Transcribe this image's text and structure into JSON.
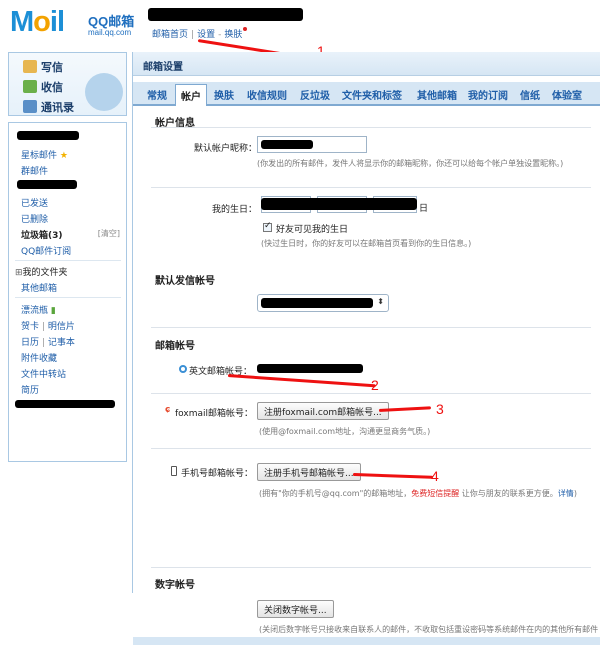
{
  "header": {
    "logo_main": "M",
    "logo_rest": "il",
    "logo_dot": "o",
    "product": "QQ邮箱",
    "domain": "mail.qq.com",
    "links": [
      "邮箱首页",
      "设置",
      "换肤"
    ]
  },
  "quick_actions": [
    "写信",
    "收信",
    "通讯录"
  ],
  "folders": {
    "starred": "星标邮件",
    "group": "群邮件",
    "sent": "已发送",
    "deleted": "已删除",
    "spam": "垃圾箱(3)",
    "clear": "[清空]",
    "subscriptions": "QQ邮件订阅",
    "my_folders": "我的文件夹",
    "other_accounts": "其他邮箱",
    "drift_bottle": "漂流瓶",
    "cards": "贺卡",
    "postcard": "明信片",
    "calendar": "日历",
    "notes": "记事本",
    "attachments": "附件收藏",
    "file_transfer": "文件中转站",
    "resume": "简历"
  },
  "main": {
    "title": "邮箱设置",
    "tabs": [
      "常规",
      "帐户",
      "换肤",
      "收信规则",
      "反垃圾",
      "文件夹和标签",
      "其他邮箱",
      "我的订阅",
      "信纸",
      "体验室"
    ],
    "active_tab": "帐户"
  },
  "account_info": {
    "section": "帐户信息",
    "nickname_label": "默认帐户昵称：",
    "nickname_hint": "(你发出的所有邮件，发件人将显示你的邮箱昵称，你还可以给每个帐户单独设置昵称。)",
    "birthday_label": "我的生日：",
    "birthday_day_suffix": "日",
    "birthday_checkbox": "好友可见我的生日",
    "birthday_hint": "(快过生日时，你的好友可以在邮箱首页看到你的生日信息。)"
  },
  "default_sender": {
    "section": "默认发信帐号"
  },
  "mail_accounts": {
    "section": "邮箱帐号",
    "english_label": "英文邮箱帐号：",
    "foxmail_label": "foxmail邮箱帐号：",
    "foxmail_button": "注册foxmail.com邮箱帐号...",
    "foxmail_hint": "(使用@foxmail.com地址，沟通更显商务气质。)",
    "phone_label": "手机号邮箱帐号：",
    "phone_button": "注册手机号邮箱帐号...",
    "phone_hint_a": "(拥有\"你的手机号@qq.com\"的邮箱地址，",
    "phone_hint_warn": "免费短信提醒",
    "phone_hint_b": " 让你与朋友的联系更方便。",
    "phone_hint_link": "详情",
    "phone_hint_end": ")"
  },
  "digital_account": {
    "section": "数字帐号",
    "close_button": "关闭数字帐号...",
    "hint": "(关闭后数字帐号只接收来自联系人的邮件，不收取包括重设密码等系统邮件在内的其他所有邮件"
  },
  "annotations": [
    "1",
    "2",
    "3",
    "4"
  ],
  "colors": {
    "accent": "#1f5ea8",
    "annotation": "#e11111",
    "tab_bg": "#d6e6f4"
  }
}
